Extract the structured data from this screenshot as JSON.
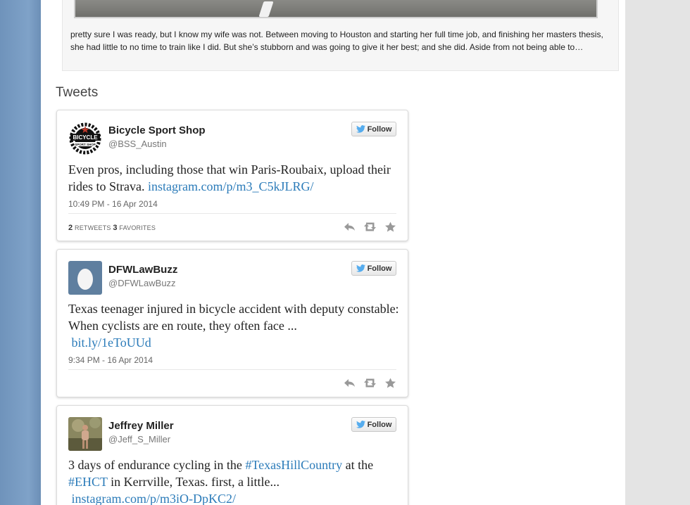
{
  "post": {
    "excerpt": "pretty sure I was ready, but I know my wife was not. Between moving to Houston and starting her full time job, and finishing her masters thesis, she had little to no time to train like I did. But she’s stubborn and was going to  give it her best; and she did. Aside from not being able to…"
  },
  "tweets_section": {
    "heading": "Tweets",
    "follow_label": "Follow",
    "retweets_label": "RETWEETS",
    "favorites_label": "FAVORITES",
    "items": [
      {
        "name": "Bicycle Sport Shop",
        "handle": "@BSS_Austin",
        "avatar_text_1": "BICYCLE",
        "avatar_text_2": "SPORT SHOP",
        "text": "Even pros, including those that win Paris-Roubaix, upload their rides to Strava. ",
        "link": "instagram.com/p/m3_C5kJLRG/",
        "timestamp": "10:49 PM - 16 Apr 2014",
        "retweets": "2",
        "favorites": "3"
      },
      {
        "name": "DFWLawBuzz",
        "handle": "@DFWLawBuzz",
        "text": "Texas teenager injured in bicycle accident with deputy constable: When cyclists are en route, they often face ...",
        "link": "bit.ly/1eToUUd",
        "timestamp": "9:34 PM - 16 Apr 2014"
      },
      {
        "name": "Jeffrey Miller",
        "handle": "@Jeff_S_Miller",
        "text_1": "3 days of endurance cycling in the ",
        "hashtag_1": "#TexasHillCountry",
        "text_2": " at the ",
        "hashtag_2": "#EHCT",
        "text_3": " in Kerrville, Texas. first, a little...",
        "link": "instagram.com/p/m3iO-DpKC2/"
      }
    ]
  },
  "colors": {
    "link": "#2b7bb9",
    "twitter_bird": "#55acee",
    "sidebar_left": "#7da0c4",
    "sidebar_right": "#e4e4e4",
    "egg_avatar_bg": "#5f7f9f"
  },
  "icons": [
    "twitter-bird-icon",
    "reply-icon",
    "retweet-icon",
    "favorite-star-icon"
  ]
}
